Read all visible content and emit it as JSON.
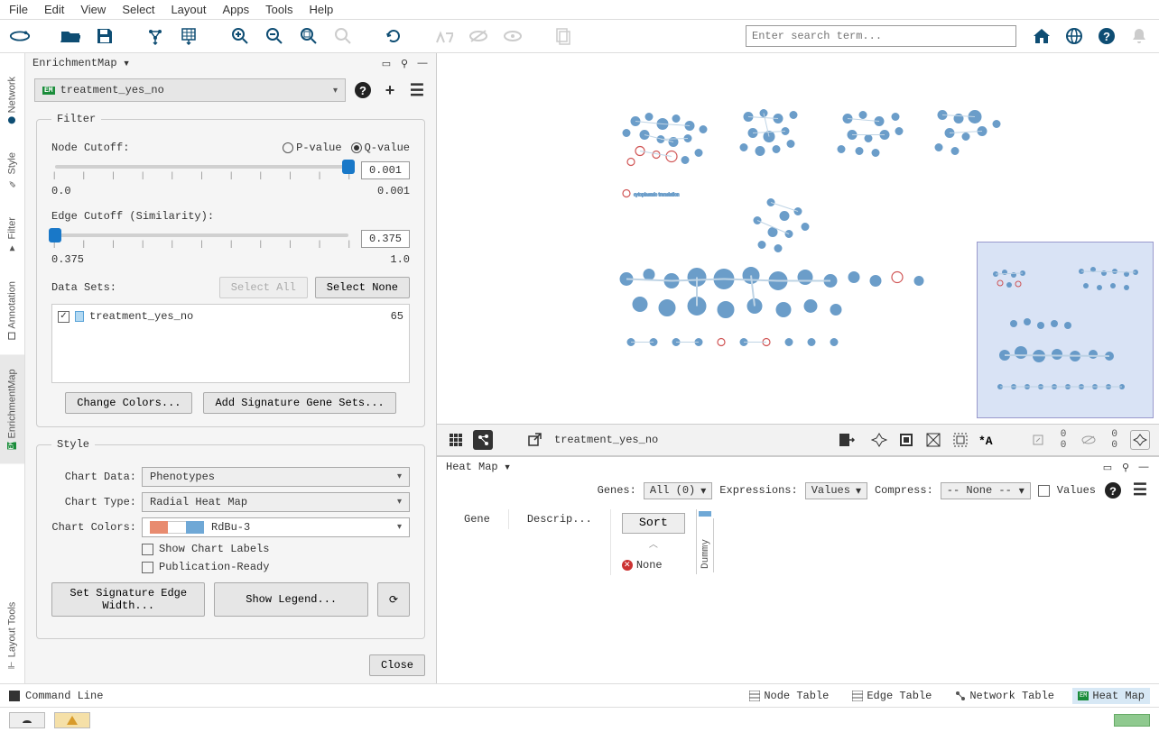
{
  "menu": [
    "File",
    "Edit",
    "View",
    "Select",
    "Layout",
    "Apps",
    "Tools",
    "Help"
  ],
  "search": {
    "placeholder": "Enter search term..."
  },
  "leftTabs": [
    "Network",
    "Style",
    "Filter",
    "Annotation",
    "EnrichmentMap"
  ],
  "layoutToolsTab": "Layout Tools",
  "panel": {
    "title": "EnrichmentMap",
    "network": "treatment_yes_no",
    "filter": {
      "legend": "Filter",
      "nodeCutoffLabel": "Node Cutoff:",
      "pvalue": "P-value",
      "qvalue": "Q-value",
      "nodeMin": "0.0",
      "nodeMax": "0.001",
      "nodeVal": "0.001",
      "edgeCutoffLabel": "Edge Cutoff (Similarity):",
      "edgeMin": "0.375",
      "edgeMax": "1.0",
      "edgeVal": "0.375",
      "dataSetsLabel": "Data Sets:",
      "selectAll": "Select All",
      "selectNone": "Select None",
      "dataset": {
        "name": "treatment_yes_no",
        "count": "65"
      },
      "changeColors": "Change Colors...",
      "addSig": "Add Signature Gene Sets..."
    },
    "style": {
      "legend": "Style",
      "chartDataLabel": "Chart Data:",
      "chartData": "Phenotypes",
      "chartTypeLabel": "Chart Type:",
      "chartType": "Radial Heat Map",
      "chartColorsLabel": "Chart Colors:",
      "chartColors": "RdBu-3",
      "showLabels": "Show Chart Labels",
      "pubReady": "Publication-Ready",
      "setSigEdge": "Set Signature Edge Width...",
      "showLegend": "Show Legend..."
    },
    "close": "Close"
  },
  "canvasToolbar": {
    "networkName": "treatment_yes_no",
    "counts": {
      "n1": "0",
      "n2": "0",
      "e1": "0",
      "e2": "0"
    }
  },
  "heatmap": {
    "title": "Heat Map",
    "genesLabel": "Genes:",
    "genesVal": "All (0)",
    "exprLabel": "Expressions:",
    "exprVal": "Values",
    "compressLabel": "Compress:",
    "compressVal": "-- None --",
    "valuesLabel": "Values",
    "colGene": "Gene",
    "colDescrip": "Descrip...",
    "sort": "Sort",
    "none": "None",
    "dummy": "Dummy"
  },
  "bottomTabs": {
    "commandLine": "Command Line",
    "nodeTable": "Node Table",
    "edgeTable": "Edge Table",
    "networkTable": "Network Table",
    "heatMap": "Heat Map"
  }
}
